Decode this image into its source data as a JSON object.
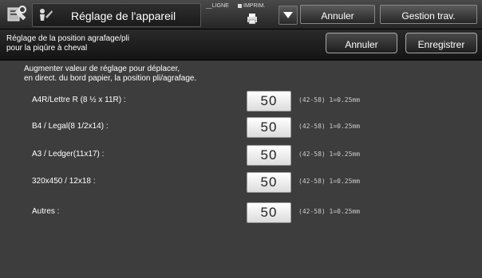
{
  "header": {
    "title": "Réglage de l'appareil",
    "status_line": "LIGNE",
    "status_print": "IMPRIM.",
    "cancel_label": "Annuler",
    "job_label": "Gestion trav."
  },
  "subheader": {
    "title_line1": "Réglage de la position agrafage/pli",
    "title_line2": "pour la piqûre à cheval",
    "cancel_label": "Annuler",
    "save_label": "Enregistrer"
  },
  "content": {
    "instruction_line1": "Augmenter valeur de réglage pour déplacer,",
    "instruction_line2": "en direct. du bord papier, la position pli/agrafage.",
    "rows": [
      {
        "label": "A4R/Lettre R (8 ½ x 11R) :",
        "value": "50",
        "range": "(42-58) 1=0.25mm"
      },
      {
        "label": "B4 / Legal(8 1/2x14) :",
        "value": "50",
        "range": "(42-58) 1=0.25mm"
      },
      {
        "label": "A3 / Ledger(11x17) :",
        "value": "50",
        "range": "(42-58) 1=0.25mm"
      },
      {
        "label": "320x450 / 12x18 :",
        "value": "50",
        "range": "(42-58) 1=0.25mm"
      },
      {
        "label": "Autres :",
        "value": "50",
        "range": "(42-58) 1=0.25mm"
      }
    ]
  }
}
